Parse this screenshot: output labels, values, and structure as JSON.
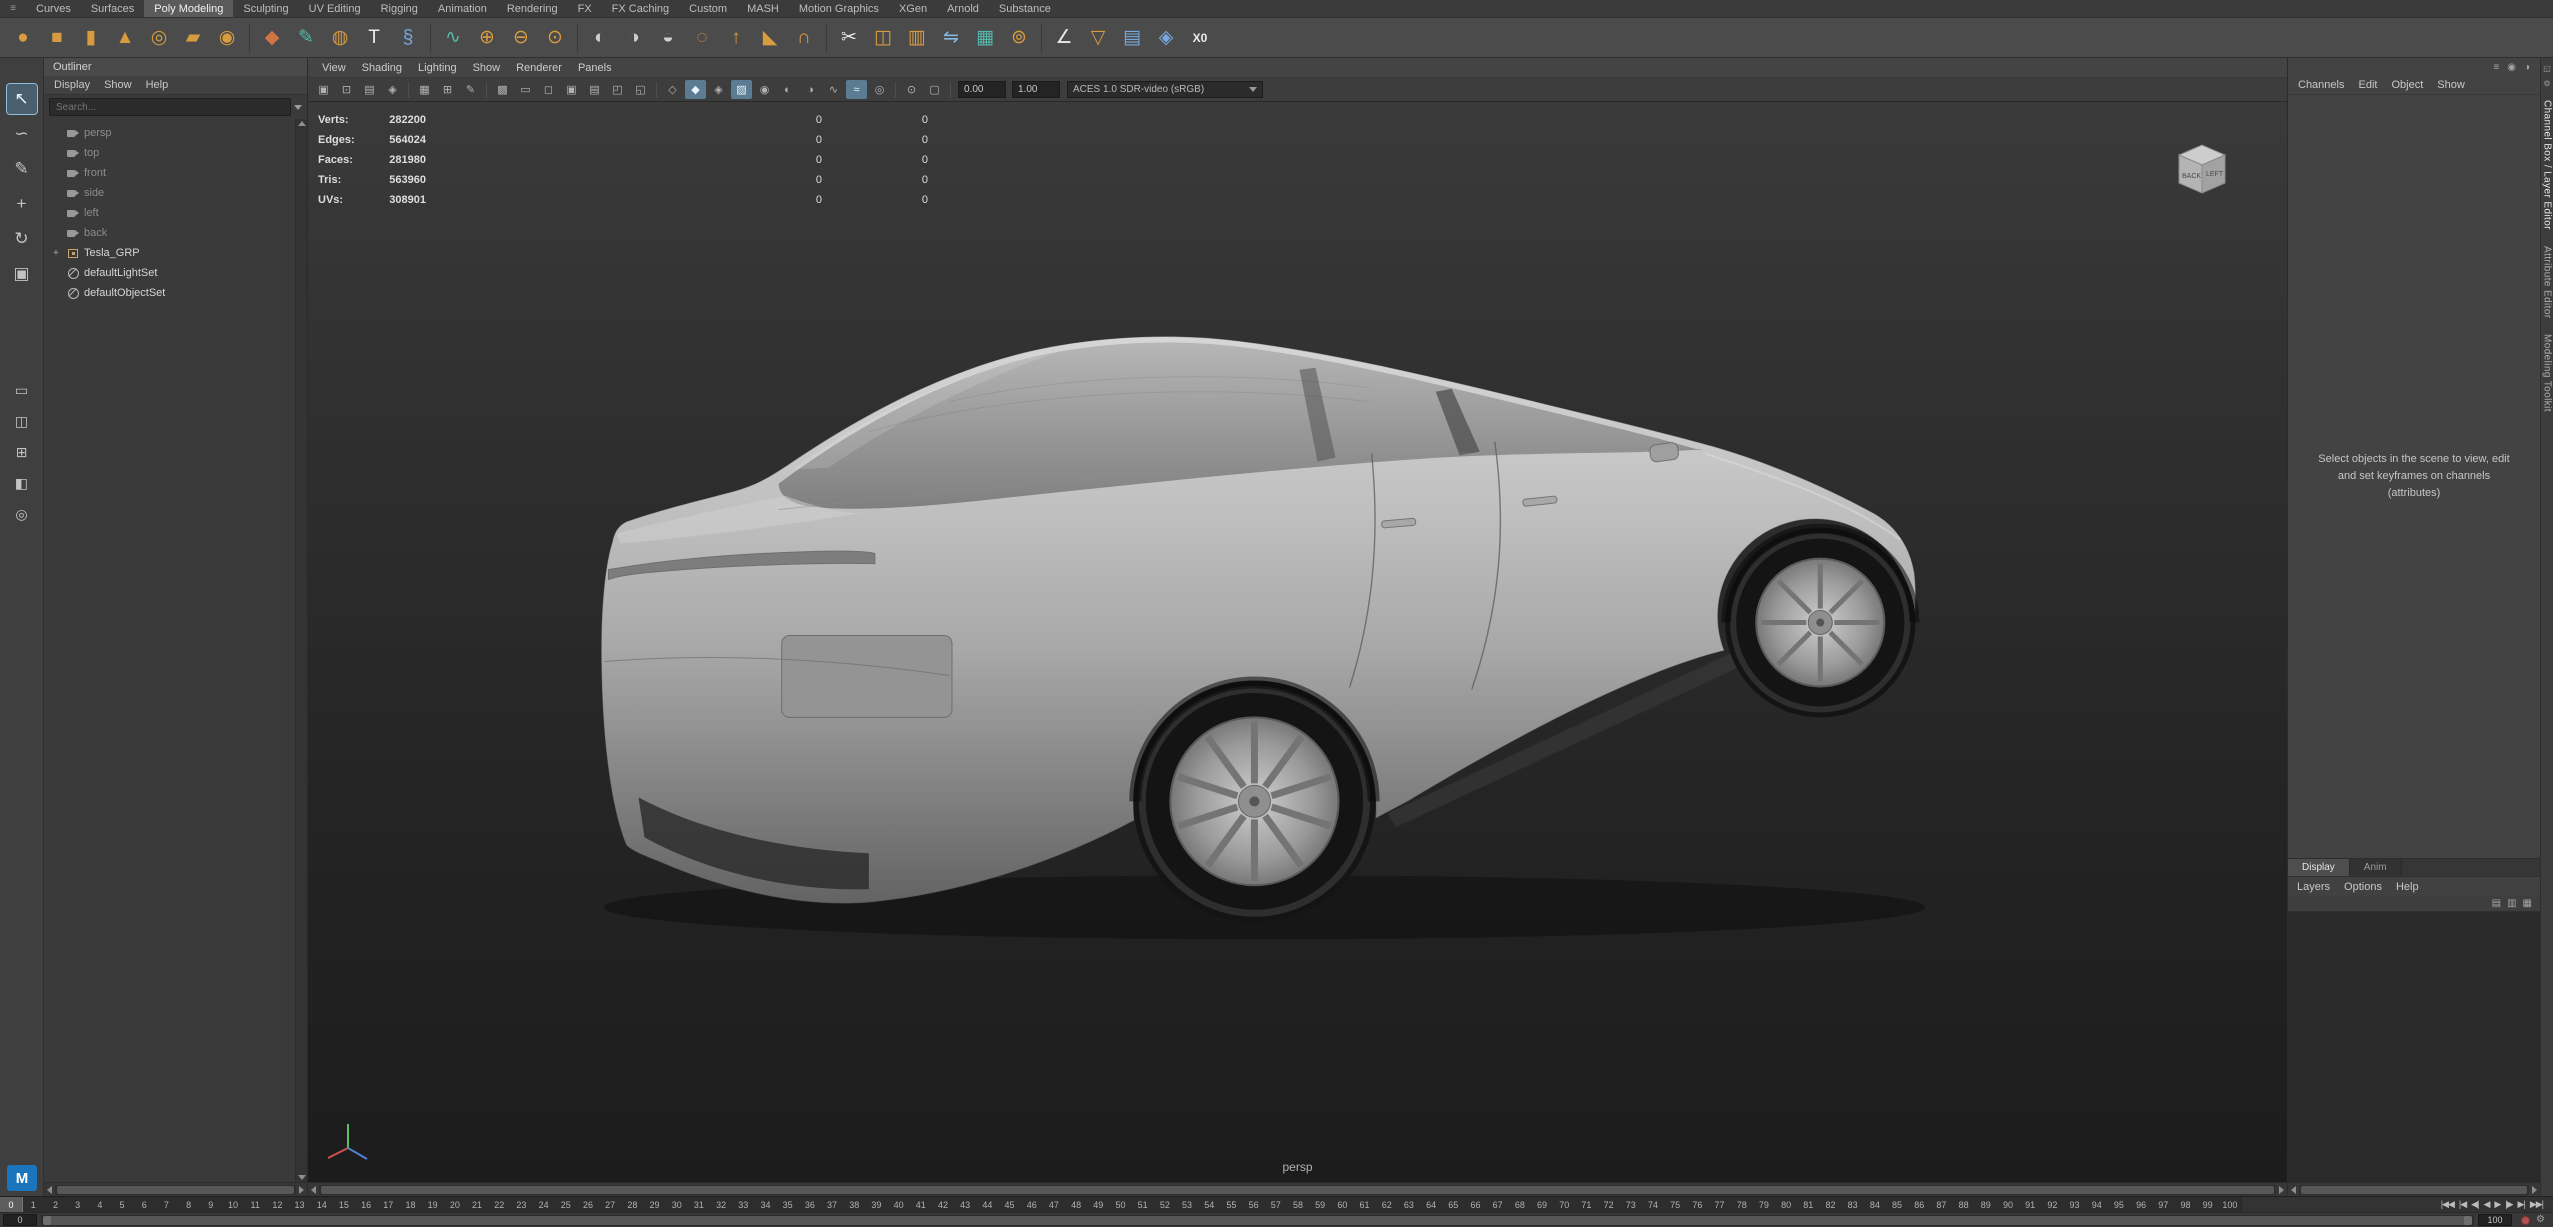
{
  "shelf_tabs": {
    "active_index": 2,
    "items": [
      "Curves",
      "Surfaces",
      "Poly Modeling",
      "Sculpting",
      "UV Editing",
      "Rigging",
      "Animation",
      "Rendering",
      "FX",
      "FX Caching",
      "Custom",
      "MASH",
      "Motion Graphics",
      "XGen",
      "Arnold",
      "Substance"
    ]
  },
  "shelf_icons": [
    {
      "name": "poly-sphere",
      "glyph": "●",
      "color": "#d89b3f"
    },
    {
      "name": "poly-cube",
      "glyph": "■",
      "color": "#d89b3f"
    },
    {
      "name": "poly-cylinder",
      "glyph": "▮",
      "color": "#d89b3f"
    },
    {
      "name": "poly-cone",
      "glyph": "▲",
      "color": "#d89b3f"
    },
    {
      "name": "poly-torus",
      "glyph": "◎",
      "color": "#d89b3f"
    },
    {
      "name": "poly-plane",
      "glyph": "▰",
      "color": "#d89b3f"
    },
    {
      "name": "poly-disc",
      "glyph": "◉",
      "color": "#d89b3f"
    },
    {
      "name": "platonic-solid",
      "glyph": "◆",
      "color": "#cd7544",
      "sep_before": true
    },
    {
      "name": "create-polygon-tool",
      "glyph": "✎",
      "color": "#54b8ac"
    },
    {
      "name": "sculpt-tool",
      "glyph": "◍",
      "color": "#d89b3f"
    },
    {
      "name": "type-tool",
      "glyph": "T",
      "color": "#ececec"
    },
    {
      "name": "svg-tool",
      "glyph": "§",
      "color": "#77a8dd"
    },
    {
      "name": "sweep-mesh",
      "glyph": "∿",
      "color": "#54b8ac",
      "sep_before": true
    },
    {
      "name": "combine",
      "glyph": "⊕",
      "color": "#d89b3f"
    },
    {
      "name": "separate",
      "glyph": "⊖",
      "color": "#d89b3f"
    },
    {
      "name": "extract",
      "glyph": "⊙",
      "color": "#d89b3f"
    },
    {
      "name": "boolean-union",
      "glyph": "◐",
      "color": "#cfcfcf",
      "sep_before": true
    },
    {
      "name": "boolean-difference",
      "glyph": "◑",
      "color": "#cfcfcf"
    },
    {
      "name": "boolean-intersection",
      "glyph": "◒",
      "color": "#cfcfcf"
    },
    {
      "name": "smooth",
      "glyph": "◌",
      "color": "#d89b3f"
    },
    {
      "name": "extrude",
      "glyph": "↑",
      "color": "#d89b3f"
    },
    {
      "name": "bevel",
      "glyph": "◣",
      "color": "#d89b3f"
    },
    {
      "name": "bridge",
      "glyph": "∩",
      "color": "#d89b3f"
    },
    {
      "name": "multi-cut",
      "glyph": "✂",
      "color": "#e8e8e8",
      "sep_before": true
    },
    {
      "name": "insert-edge-loop",
      "glyph": "◫",
      "color": "#d89b3f"
    },
    {
      "name": "offset-edge-loop",
      "glyph": "▥",
      "color": "#d89b3f"
    },
    {
      "name": "mirror",
      "glyph": "⇋",
      "color": "#85b7e3"
    },
    {
      "name": "quad-draw",
      "glyph": "▦",
      "color": "#54b8ac"
    },
    {
      "name": "target-weld",
      "glyph": "⊚",
      "color": "#d89b3f"
    },
    {
      "name": "crease-tool",
      "glyph": "∠",
      "color": "#e8e8e8",
      "sep_before": true
    },
    {
      "name": "reduce",
      "glyph": "▽",
      "color": "#d89b3f"
    },
    {
      "name": "retopologize",
      "glyph": "▤",
      "color": "#77a8dd"
    },
    {
      "name": "remesh",
      "glyph": "◈",
      "color": "#77a8dd"
    },
    {
      "name": "zero-transform",
      "glyph": "X0",
      "color": "#ececec"
    }
  ],
  "left_toolbar": {
    "logo": "M",
    "tools": [
      {
        "name": "select-tool",
        "glyph": "↖",
        "active": true
      },
      {
        "name": "lasso-tool",
        "glyph": "∽"
      },
      {
        "name": "paint-select-tool",
        "glyph": "✎"
      },
      {
        "name": "move-tool",
        "glyph": "+"
      },
      {
        "name": "rotate-tool",
        "glyph": "↻"
      },
      {
        "name": "scale-tool",
        "glyph": "▣"
      }
    ],
    "layouts": [
      {
        "name": "layout-single-pane",
        "glyph": "▭"
      },
      {
        "name": "layout-two-panes",
        "glyph": "◫"
      },
      {
        "name": "layout-four-panes",
        "glyph": "⊞"
      },
      {
        "name": "layout-outliner-persp",
        "glyph": "◧"
      },
      {
        "name": "zoom-layout-icon",
        "glyph": "◎"
      }
    ]
  },
  "outliner": {
    "title": "Outliner",
    "menus": [
      "Display",
      "Show",
      "Help"
    ],
    "search_placeholder": "Search...",
    "items": [
      {
        "label": "persp",
        "icon": "camera",
        "muted": true
      },
      {
        "label": "top",
        "icon": "camera",
        "muted": true
      },
      {
        "label": "front",
        "icon": "camera",
        "muted": true
      },
      {
        "label": "side",
        "icon": "camera",
        "muted": true
      },
      {
        "label": "left",
        "icon": "camera",
        "muted": true
      },
      {
        "label": "back",
        "icon": "camera",
        "muted": true
      },
      {
        "label": "Tesla_GRP",
        "icon": "group",
        "expandable": true
      },
      {
        "label": "defaultLightSet",
        "icon": "set"
      },
      {
        "label": "defaultObjectSet",
        "icon": "set"
      }
    ]
  },
  "viewport": {
    "menus": [
      "View",
      "Shading",
      "Lighting",
      "Show",
      "Renderer",
      "Panels"
    ],
    "toolbar_icons": [
      {
        "name": "select-camera",
        "glyph": "▣"
      },
      {
        "name": "lock-camera",
        "glyph": "⊡"
      },
      {
        "name": "camera-attributes",
        "glyph": "▤"
      },
      {
        "name": "bookmarks",
        "glyph": "◈"
      },
      {
        "name": "image-plane",
        "glyph": "▦",
        "sep_before": true
      },
      {
        "name": "pan-zoom-2d",
        "glyph": "⊞"
      },
      {
        "name": "grease-pencil",
        "glyph": "✎"
      },
      {
        "name": "grid",
        "glyph": "▩",
        "sep_before": true
      },
      {
        "name": "film-gate",
        "glyph": "▭"
      },
      {
        "name": "resolution-gate",
        "glyph": "◻"
      },
      {
        "name": "gate-mask",
        "glyph": "▣"
      },
      {
        "name": "field-chart",
        "glyph": "▤"
      },
      {
        "name": "safe-action",
        "glyph": "◰"
      },
      {
        "name": "safe-title",
        "glyph": "◱"
      },
      {
        "name": "wireframe",
        "glyph": "◇",
        "sep_before": true
      },
      {
        "name": "smooth-shade-all",
        "glyph": "◆",
        "active": true
      },
      {
        "name": "wireframe-on-shaded",
        "glyph": "◈"
      },
      {
        "name": "textured",
        "glyph": "▨",
        "active": true
      },
      {
        "name": "use-all-lights",
        "glyph": "◉"
      },
      {
        "name": "shadows",
        "glyph": "◐"
      },
      {
        "name": "screen-space-ao",
        "glyph": "◑"
      },
      {
        "name": "motion-blur",
        "glyph": "∿"
      },
      {
        "name": "anti-aliasing",
        "glyph": "≈",
        "active": true
      },
      {
        "name": "depth-of-field",
        "glyph": "◎"
      },
      {
        "name": "isolate-select",
        "glyph": "⊙",
        "sep_before": true
      },
      {
        "name": "x-ray",
        "glyph": "▢"
      }
    ],
    "exposure_value": "0.00",
    "gamma_value": "1.00",
    "view_transform": "ACES 1.0 SDR-video (sRGB)",
    "hud": [
      {
        "label": "Verts:",
        "value": "282200",
        "sel": "0",
        "sel2": "0"
      },
      {
        "label": "Edges:",
        "value": "564024",
        "sel": "0",
        "sel2": "0"
      },
      {
        "label": "Faces:",
        "value": "281980",
        "sel": "0",
        "sel2": "0"
      },
      {
        "label": "Tris:",
        "value": "563960",
        "sel": "0",
        "sel2": "0"
      },
      {
        "label": "UVs:",
        "value": "308901",
        "sel": "0",
        "sel2": "0"
      }
    ],
    "view_cube": {
      "front_face": "BACK",
      "side_face": "LEFT"
    },
    "camera_label": "persp"
  },
  "channel_box": {
    "header_icons": [
      {
        "name": "channel-display-icon",
        "glyph": "≡"
      },
      {
        "name": "channel-manip-icon",
        "glyph": "◉"
      },
      {
        "name": "channel-speed-icon",
        "glyph": "◑"
      }
    ],
    "menus": [
      "Channels",
      "Edit",
      "Object",
      "Show"
    ],
    "message": "Select objects in the scene to view, edit and set keyframes on channels (attributes)"
  },
  "layer_editor": {
    "tabs": [
      "Display",
      "Anim"
    ],
    "active_tab_index": 0,
    "menus": [
      "Layers",
      "Options",
      "Help"
    ],
    "icons": [
      {
        "name": "layer-set-all-icon",
        "glyph": "▤"
      },
      {
        "name": "layer-new-empty-icon",
        "glyph": "▥"
      },
      {
        "name": "layer-new-from-selected-icon",
        "glyph": "▦"
      }
    ]
  },
  "side_tabs": [
    {
      "label": "Channel Box / Layer Editor",
      "active": true
    },
    {
      "label": "Attribute Editor"
    },
    {
      "label": "Modeling Toolkit"
    }
  ],
  "right_strip_icons": [
    {
      "name": "dock-icon",
      "glyph": "◱"
    },
    {
      "name": "gear-icon",
      "glyph": "⚙"
    }
  ],
  "timeline": {
    "start": 0,
    "end": 100,
    "current": "0",
    "range_start": "0",
    "range_end": "100",
    "playback": [
      {
        "name": "go-to-start",
        "glyph": "|◀◀"
      },
      {
        "name": "step-back-key",
        "glyph": "|◀"
      },
      {
        "name": "step-back-frame",
        "glyph": "◀|"
      },
      {
        "name": "play-backward",
        "glyph": "◀"
      },
      {
        "name": "play-forward",
        "glyph": "▶"
      },
      {
        "name": "step-forward-frame",
        "glyph": "|▶"
      },
      {
        "name": "step-forward-key",
        "glyph": "▶|"
      },
      {
        "name": "go-to-end",
        "glyph": "▶▶|"
      }
    ]
  }
}
